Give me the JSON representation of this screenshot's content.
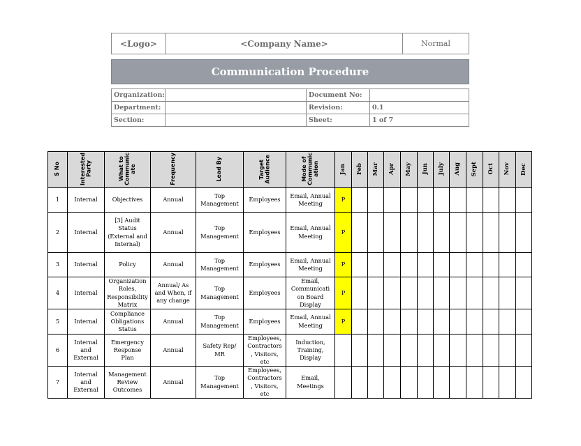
{
  "header": {
    "logo": "<Logo>",
    "company": "<Company Name>",
    "status": "Normal"
  },
  "title": "Communication Procedure",
  "meta": {
    "organization_label": "Organization:",
    "organization_value": "",
    "department_label": "Department:",
    "department_value": "",
    "section_label": "Section:",
    "section_value": "",
    "document_no_label": "Document No:",
    "document_no_value": "",
    "revision_label": "Revision:",
    "revision_value": "0.1",
    "sheet_label": "Sheet:",
    "sheet_value": "1 of 7"
  },
  "table": {
    "columns": [
      "S No",
      "Interested\nParty",
      "What to\nCommunic\nate",
      "Frequency",
      "Lead By",
      "Target\nAudience",
      "Mode of\nCommunic\nation"
    ],
    "months": [
      "Jan",
      "Feb",
      "Mar",
      "Apr",
      "May",
      "Jun",
      "July",
      "Aug",
      "Sept",
      "Oct",
      "Nov",
      "Dec"
    ],
    "highlight_color": "#ffff00",
    "rows": [
      {
        "sno": "1",
        "party": "Internal",
        "what": "Objectives",
        "frequency": "Annual",
        "lead": "Top\nManagement",
        "audience": "Employees",
        "mode": "Email, Annual\nMeeting",
        "months": [
          "P",
          "",
          "",
          "",
          "",
          "",
          "",
          "",
          "",
          "",
          "",
          ""
        ]
      },
      {
        "sno": "2",
        "party": "Internal",
        "what": "[3] Audit\nStatus\n(External and\nInternal)",
        "frequency": "Annual",
        "lead": "Top\nManagement",
        "audience": "Employees",
        "mode": "Email, Annual\nMeeting",
        "months": [
          "P",
          "",
          "",
          "",
          "",
          "",
          "",
          "",
          "",
          "",
          "",
          ""
        ]
      },
      {
        "sno": "3",
        "party": "Internal",
        "what": "Policy",
        "frequency": "Annual",
        "lead": "Top\nManagement",
        "audience": "Employees",
        "mode": "Email, Annual\nMeeting",
        "months": [
          "P",
          "",
          "",
          "",
          "",
          "",
          "",
          "",
          "",
          "",
          "",
          ""
        ]
      },
      {
        "sno": "4",
        "party": "Internal",
        "what": "Organization\nRoles,\nResponsibility\nMatrix",
        "frequency": "Annual/ As\nand When, if\nany change",
        "lead": "Top\nManagement",
        "audience": "Employees",
        "mode": "Email,\nCommunicati\non Board\nDisplay",
        "months": [
          "P",
          "",
          "",
          "",
          "",
          "",
          "",
          "",
          "",
          "",
          "",
          ""
        ]
      },
      {
        "sno": "5",
        "party": "Internal",
        "what": "Compliance\nObligations\nStatus",
        "frequency": "Annual",
        "lead": "Top\nManagement",
        "audience": "Employees",
        "mode": "Email, Annual\nMeeting",
        "months": [
          "P",
          "",
          "",
          "",
          "",
          "",
          "",
          "",
          "",
          "",
          "",
          ""
        ]
      },
      {
        "sno": "6",
        "party": "Internal\nand\nExternal",
        "what": "Emergency\nResponse\nPlan",
        "frequency": "Annual",
        "lead": "Safety Rep/\nMR",
        "audience": "Employees,\nContractors\n, Visitors,\netc",
        "mode": "Induction,\nTraining,\nDisplay",
        "months": [
          "",
          "",
          "",
          "",
          "",
          "",
          "",
          "",
          "",
          "",
          "",
          ""
        ]
      },
      {
        "sno": "7",
        "party": "Internal\nand\nExternal",
        "what": "Management\nReview\nOutcomes",
        "frequency": "Annual",
        "lead": "Top\nManagement",
        "audience": "Employees,\nContractors\n, Visitors,\netc",
        "mode": "Email,\nMeetings",
        "months": [
          "",
          "",
          "",
          "",
          "",
          "",
          "",
          "",
          "",
          "",
          "",
          ""
        ]
      }
    ]
  }
}
